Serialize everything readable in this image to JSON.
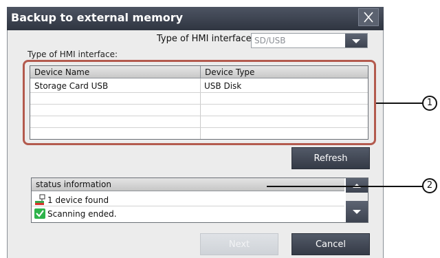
{
  "window": {
    "title": "Backup to external memory",
    "close_icon": "close-icon"
  },
  "interface": {
    "label": "Type of HMI interface:",
    "selected": "SD/USB",
    "dropdown_icon": "chevron-down-icon"
  },
  "device_group": {
    "label": "Type of HMI interface:"
  },
  "table": {
    "columns": [
      "Device Name",
      "Device Type"
    ],
    "rows": [
      [
        "Storage Card USB",
        "USB Disk"
      ],
      [
        "",
        ""
      ],
      [
        "",
        ""
      ],
      [
        "",
        ""
      ],
      [
        "",
        ""
      ]
    ]
  },
  "buttons": {
    "refresh": "Refresh",
    "next": "Next",
    "cancel": "Cancel"
  },
  "status": {
    "header": "status information",
    "messages": [
      {
        "icon": "network-device-icon",
        "text": "1 device found"
      },
      {
        "icon": "checkmark-icon",
        "text": "Scanning ended."
      }
    ]
  },
  "callouts": [
    "1",
    "2"
  ],
  "colors": {
    "titlebar": "#3a4150",
    "button": "#3f4552",
    "highlight": "#b35a4e",
    "check": "#2db34a"
  }
}
